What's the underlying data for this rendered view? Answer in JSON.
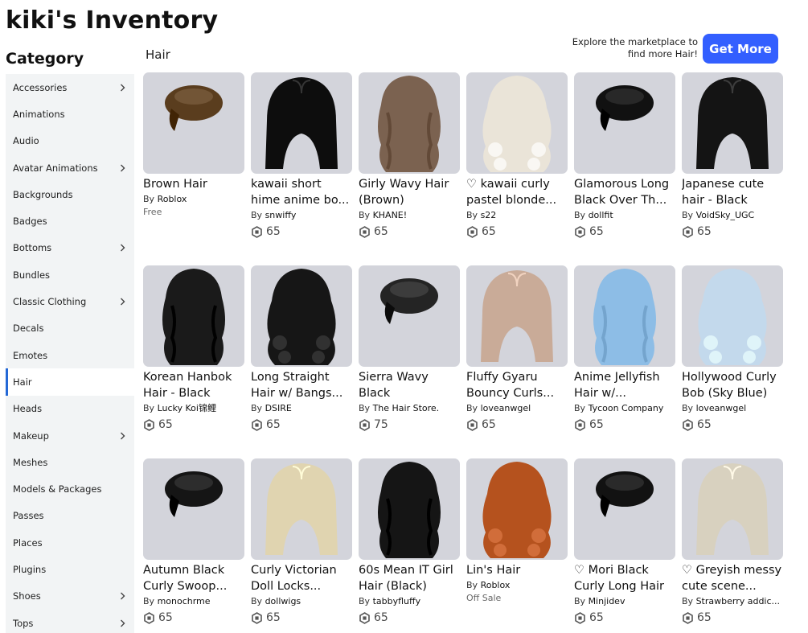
{
  "page": {
    "title": "kiki's Inventory"
  },
  "sidebar": {
    "heading": "Category",
    "items": [
      {
        "label": "Accessories",
        "chevron": true,
        "active": false
      },
      {
        "label": "Animations",
        "chevron": false,
        "active": false
      },
      {
        "label": "Audio",
        "chevron": false,
        "active": false
      },
      {
        "label": "Avatar Animations",
        "chevron": true,
        "active": false
      },
      {
        "label": "Backgrounds",
        "chevron": false,
        "active": false
      },
      {
        "label": "Badges",
        "chevron": false,
        "active": false
      },
      {
        "label": "Bottoms",
        "chevron": true,
        "active": false
      },
      {
        "label": "Bundles",
        "chevron": false,
        "active": false
      },
      {
        "label": "Classic Clothing",
        "chevron": true,
        "active": false
      },
      {
        "label": "Decals",
        "chevron": false,
        "active": false
      },
      {
        "label": "Emotes",
        "chevron": false,
        "active": false
      },
      {
        "label": "Hair",
        "chevron": false,
        "active": true
      },
      {
        "label": "Heads",
        "chevron": false,
        "active": false
      },
      {
        "label": "Makeup",
        "chevron": true,
        "active": false
      },
      {
        "label": "Meshes",
        "chevron": false,
        "active": false
      },
      {
        "label": "Models & Packages",
        "chevron": false,
        "active": false
      },
      {
        "label": "Passes",
        "chevron": false,
        "active": false
      },
      {
        "label": "Places",
        "chevron": false,
        "active": false
      },
      {
        "label": "Plugins",
        "chevron": false,
        "active": false
      },
      {
        "label": "Shoes",
        "chevron": true,
        "active": false
      },
      {
        "label": "Tops",
        "chevron": true,
        "active": false
      }
    ]
  },
  "main": {
    "section_label": "Hair",
    "promo_line1": "Explore the marketplace to",
    "promo_line2": "find more Hair!",
    "get_more_label": "Get More",
    "by_label": "By",
    "items": [
      {
        "line1": "Brown Hair",
        "line2": "",
        "creator": "Roblox",
        "price": "",
        "status": "Free",
        "hair_color": "#5a3d1e"
      },
      {
        "line1": "kawaii short",
        "line2": "hime anime bo...",
        "creator": "snwiffy",
        "price": "65",
        "status": "",
        "hair_color": "#0d0d0d"
      },
      {
        "line1": "Girly Wavy Hair",
        "line2": "(Brown)",
        "creator": "KHANE!",
        "price": "65",
        "status": "",
        "hair_color": "#7b6250"
      },
      {
        "line1": "♡ kawaii curly",
        "line2": "pastel blonde...",
        "creator": "s22",
        "price": "65",
        "status": "",
        "hair_color": "#eae4d8"
      },
      {
        "line1": "Glamorous Long",
        "line2": "Black Over Th...",
        "creator": "dollfit",
        "price": "65",
        "status": "",
        "hair_color": "#111111"
      },
      {
        "line1": "Japanese cute",
        "line2": "hair - Black",
        "creator": "VoidSky_UGC",
        "price": "65",
        "status": "",
        "hair_color": "#141414"
      },
      {
        "line1": "Korean Hanbok",
        "line2": "Hair - Black",
        "creator": "Lucky Koi锦鲤",
        "price": "65",
        "status": "",
        "hair_color": "#1a1a1a"
      },
      {
        "line1": "Long Straight",
        "line2": "Hair w/ Bangs...",
        "creator": "DSIRE",
        "price": "65",
        "status": "",
        "hair_color": "#161616"
      },
      {
        "line1": "Sierra Wavy",
        "line2": "Black",
        "creator": "The Hair Store.",
        "price": "75",
        "status": "",
        "hair_color": "#242424"
      },
      {
        "line1": "Fluffy Gyaru",
        "line2": "Bouncy Curls...",
        "creator": "loveanwgel",
        "price": "65",
        "status": "",
        "hair_color": "#c9ab98"
      },
      {
        "line1": "Anime Jellyfish",
        "line2": "Hair w/...",
        "creator": "Tycoon Company",
        "price": "65",
        "status": "",
        "hair_color": "#8dbde6"
      },
      {
        "line1": "Hollywood Curly",
        "line2": "Bob (Sky Blue)",
        "creator": "loveanwgel",
        "price": "65",
        "status": "",
        "hair_color": "#c3d9ec"
      },
      {
        "line1": "Autumn Black",
        "line2": "Curly Swoop...",
        "creator": "monochrme",
        "price": "65",
        "status": "",
        "hair_color": "#151515"
      },
      {
        "line1": "Curly Victorian",
        "line2": "Doll Locks...",
        "creator": "dollwigs",
        "price": "65",
        "status": "",
        "hair_color": "#e0d4b0"
      },
      {
        "line1": "60s Mean IT Girl",
        "line2": "Hair (Black)",
        "creator": "tabbyfluffy",
        "price": "65",
        "status": "",
        "hair_color": "#151515"
      },
      {
        "line1": "Lin's Hair",
        "line2": "",
        "creator": "Roblox",
        "price": "",
        "status": "Off Sale",
        "hair_color": "#b5521e"
      },
      {
        "line1": "♡ Mori Black",
        "line2": "Curly Long Hair",
        "creator": "Minjidev",
        "price": "65",
        "status": "",
        "hair_color": "#121212"
      },
      {
        "line1": "♡ Greyish messy",
        "line2": "cute scene...",
        "creator": "Strawberry addic...",
        "price": "65",
        "status": "",
        "hair_color": "#d8d1bf"
      }
    ]
  },
  "colors": {
    "accent": "#335fff",
    "active_bar": "#2468d6",
    "sidebar_bg": "#f2f4f5",
    "thumb_bg": "#d3d4db"
  },
  "icons": {
    "chevron": "chevron-right-icon",
    "robux": "robux-icon"
  }
}
